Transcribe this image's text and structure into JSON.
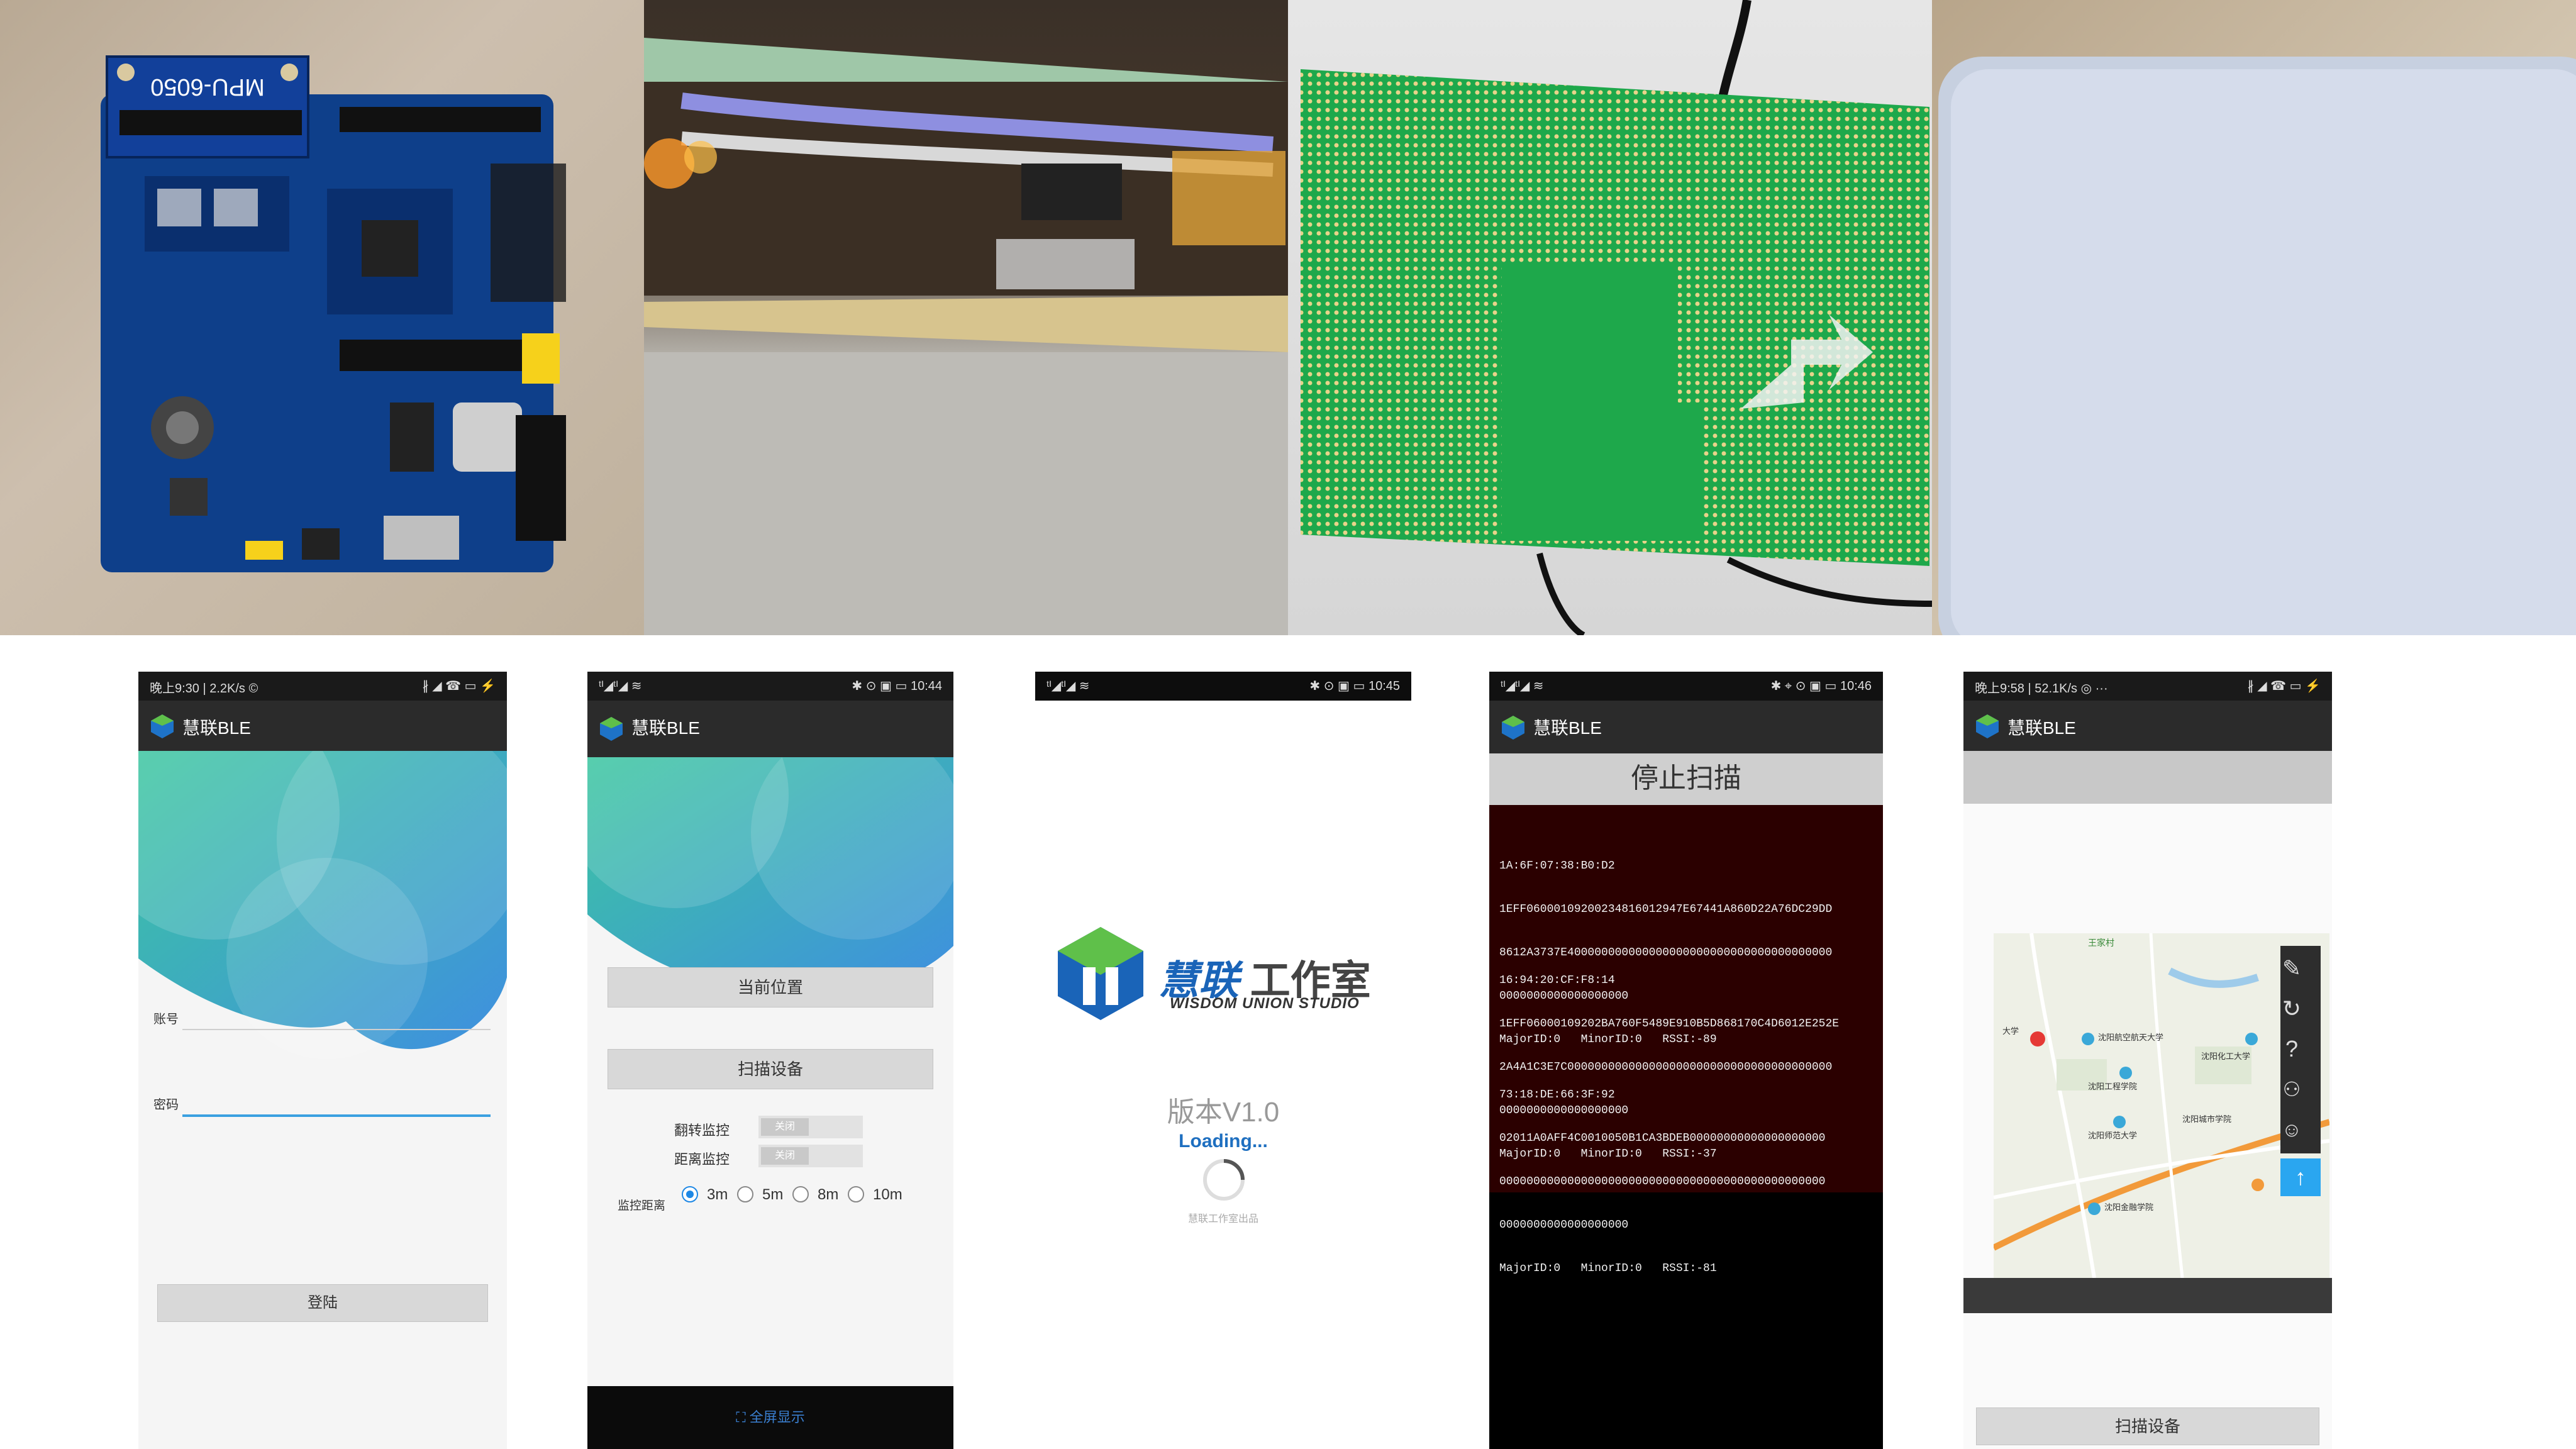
{
  "photos": {
    "board_silk": "MPU-6050"
  },
  "phone1": {
    "status_left": "晚上9:30 | 2.2K/s ©",
    "status_right": "∦ ◢ ☎ ▭ ⚡",
    "app_title": "慧联BLE",
    "account_label": "账号",
    "password_label": "密码",
    "login_button": "登陆"
  },
  "phone2": {
    "status_left": "ᵗᴵ◢ᵗᴵ◢ ≋",
    "status_right": "✱ ⊙ ▣ ▭ 10:44",
    "app_title": "慧联BLE",
    "location_button": "当前位置",
    "scan_button": "扫描设备",
    "flip_label": "翻转监控",
    "distance_label": "距离监控",
    "toggle_off": "关闭",
    "range_label": "监控距离",
    "ranges": [
      "3m",
      "5m",
      "8m",
      "10m"
    ],
    "selected_range": "3m",
    "fullscreen_label": "全屏显示"
  },
  "phone3": {
    "status_left": "ᵗᴵ◢ᵗᴵ◢ ≋",
    "status_right": "✱ ⊙ ▣ ▭ 10:45",
    "studio_name_cn": "慧联",
    "studio_name_cn2": "工作室",
    "studio_name_en": "WISDOM UNION STUDIO",
    "version": "版本V1.0",
    "loading": "Loading...",
    "footer": "慧联工作室出品"
  },
  "phone4": {
    "status_left": "ᵗᴵ◢ᵗᴵ◢ ≋",
    "status_right": "✱ ⌖ ⊙ ▣ ▭ 10:46",
    "app_title": "慧联BLE",
    "stop_scan_button": "停止扫描",
    "devices": [
      {
        "mac": "1A:6F:07:38:B0:D2",
        "raw": [
          "1EFF06000109200234816012947E67441A860D22A76DC29DD",
          "8612A3737E400000000000000000000000000000000000000",
          "0000000000000000000"
        ],
        "info": "MajorID:0   MinorID:0   RSSI:-89"
      },
      {
        "mac": "16:94:20:CF:F8:14",
        "raw": [
          "1EFF06000109202BA760F5489E910B5D868170C4D6012E252E",
          "2A4A1C3E7C000000000000000000000000000000000000000",
          "0000000000000000000"
        ],
        "info": "MajorID:0   MinorID:0   RSSI:-37"
      },
      {
        "mac": "73:18:DE:66:3F:92",
        "raw": [
          "02011A0AFF4C0010050B1CA3BDEB00000000000000000000",
          "000000000000000000000000000000000000000000000000",
          "0000000000000000000"
        ],
        "info": "MajorID:0   MinorID:0   RSSI:-81"
      }
    ]
  },
  "phone5": {
    "status_left": "晚上9:58 | 52.1K/s ◎ ···",
    "status_right": "∦ ◢ ☎ ▭ ⚡",
    "app_title": "慧联BLE",
    "scan_button": "扫描设备",
    "map_labels": [
      "王家村",
      "沈阳航空航天大学",
      "沈阳工程学院",
      "沈阳师范大学",
      "沈阳化工大学",
      "沈阳金融学院",
      "沈阳城市学院",
      "大学"
    ]
  }
}
